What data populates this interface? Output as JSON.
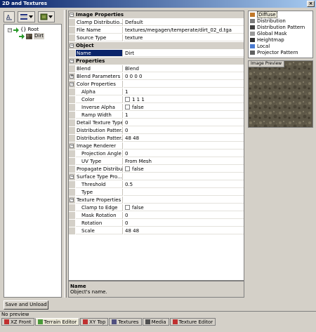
{
  "window": {
    "title": "2D and Textures"
  },
  "tree": {
    "root_label": "Root",
    "child_label": "Dirt"
  },
  "properties": {
    "rows": [
      {
        "kind": "category",
        "label": "Image Properties"
      },
      {
        "kind": "prop",
        "name": "Clamp Distributio...",
        "value": "Default"
      },
      {
        "kind": "prop",
        "name": "File Name",
        "value": "textures/megagen/temperate/dirt_02_d.tga"
      },
      {
        "kind": "prop",
        "name": "Source Type",
        "value": "texture"
      },
      {
        "kind": "category",
        "label": "Object"
      },
      {
        "kind": "prop",
        "name": "Name",
        "value": "Dirt",
        "selected": true
      },
      {
        "kind": "category",
        "label": "Properties"
      },
      {
        "kind": "prop",
        "name": "Blend",
        "value": "Blend"
      },
      {
        "kind": "prop",
        "name": "Blend Parameters",
        "value": "0 0 0 0",
        "expandable": true
      },
      {
        "kind": "prop",
        "name": "Color Properties",
        "value": "",
        "expandable": true,
        "open": true
      },
      {
        "kind": "prop",
        "name": "Alpha",
        "value": "1",
        "sub": true
      },
      {
        "kind": "prop",
        "name": "Color",
        "value": "1 1 1",
        "sub": true,
        "swatch": true
      },
      {
        "kind": "prop",
        "name": "Inverse Alpha",
        "value": "false",
        "sub": true,
        "checkbox": true
      },
      {
        "kind": "prop",
        "name": "Ramp Width",
        "value": "1",
        "sub": true
      },
      {
        "kind": "prop",
        "name": "Detail Texture Type",
        "value": "0"
      },
      {
        "kind": "prop",
        "name": "Distribution Patter...",
        "value": "0"
      },
      {
        "kind": "prop",
        "name": "Distribution Patter...",
        "value": "48 48"
      },
      {
        "kind": "prop",
        "name": "Image Renderer",
        "value": "",
        "expandable": true,
        "open": true
      },
      {
        "kind": "prop",
        "name": "Projection Angle",
        "value": "0",
        "sub": true
      },
      {
        "kind": "prop",
        "name": "UV Type",
        "value": "From Mesh",
        "sub": true
      },
      {
        "kind": "prop",
        "name": "Propagate Distribution",
        "value": "false",
        "checkbox": true
      },
      {
        "kind": "prop",
        "name": "Surface Type Pro...",
        "value": "",
        "expandable": true,
        "open": true
      },
      {
        "kind": "prop",
        "name": "Threshold",
        "value": "0.5",
        "sub": true
      },
      {
        "kind": "prop",
        "name": "Type",
        "value": "",
        "sub": true
      },
      {
        "kind": "prop",
        "name": "Texture Properties",
        "value": "",
        "expandable": true,
        "open": true
      },
      {
        "kind": "prop",
        "name": "Clamp to Edge",
        "value": "false",
        "sub": true,
        "checkbox": true
      },
      {
        "kind": "prop",
        "name": "Mask Rotation",
        "value": "0",
        "sub": true
      },
      {
        "kind": "prop",
        "name": "Rotation",
        "value": "0",
        "sub": true
      },
      {
        "kind": "prop",
        "name": "Scale",
        "value": "48 48",
        "sub": true
      }
    ]
  },
  "description": {
    "title": "Name",
    "text": "Object's name."
  },
  "layers": {
    "items": [
      {
        "label": "Diffuse",
        "color": "#c0782a",
        "selected": true
      },
      {
        "label": "Distribution",
        "color": "#7a7a7a"
      },
      {
        "label": "Distribution Pattern",
        "color": "#404040"
      },
      {
        "label": "Global Mask",
        "color": "#9a9a9a"
      },
      {
        "label": "Heightmap",
        "color": "#303030"
      },
      {
        "label": "Local",
        "color": "#4a7ad0"
      },
      {
        "label": "Projector Pattern",
        "color": "#606060"
      }
    ]
  },
  "preview": {
    "label": "Image Preview"
  },
  "save_button": {
    "label": "Save and Unload"
  },
  "status": {
    "text": "No preview"
  },
  "tabs": [
    {
      "label": "XZ Front",
      "icon": "axis-icon",
      "color": "#c03030"
    },
    {
      "label": "Terrain Editor",
      "icon": "terrain-icon",
      "color": "#4a9a3a",
      "active": true
    },
    {
      "label": "XY Top",
      "icon": "axis-icon",
      "color": "#c03030"
    },
    {
      "label": "Textures",
      "icon": "textures-icon",
      "color": "#505080"
    },
    {
      "label": "Media",
      "icon": "media-icon",
      "color": "#505050"
    },
    {
      "label": "Texture Editor",
      "icon": "texture-editor-icon",
      "color": "#c03030"
    }
  ]
}
